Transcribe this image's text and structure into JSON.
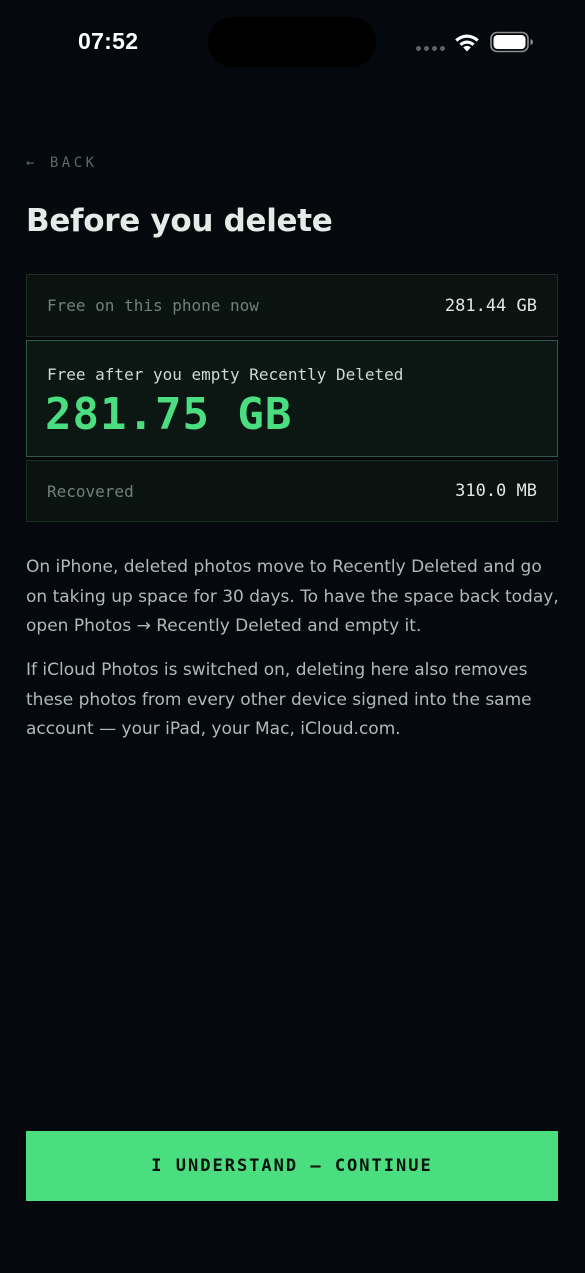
{
  "status_bar": {
    "time": "07:52",
    "icons": [
      "signal-dots-icon",
      "wifi-icon",
      "battery-icon"
    ]
  },
  "back": {
    "label": "← BACK"
  },
  "title": "Before you delete",
  "storage": {
    "free_now_label": "Free on this phone now",
    "free_now_value": "281.44 GB",
    "free_after_label": "Free after you empty Recently Deleted",
    "free_after_value": "281.75 GB",
    "recovered_label": "Recovered",
    "recovered_value": "310.0 MB"
  },
  "info": {
    "paragraph_1": "On iPhone, deleted photos move to Recently Deleted and go on taking up space for 30 days. To have the space back today, open Photos → Recently Deleted and empty it.",
    "paragraph_2": "If iCloud Photos is switched on, deleting here also removes these photos from every other device signed into the same account — your iPad, your Mac, iCloud.com."
  },
  "actions": {
    "continue_label": "I UNDERSTAND — CONTINUE"
  },
  "colors": {
    "background": "#05080c",
    "accent": "#4ade80",
    "card_background": "#0b1311",
    "card_border": "#1d2a26",
    "highlight_border": "#2e5a45"
  }
}
